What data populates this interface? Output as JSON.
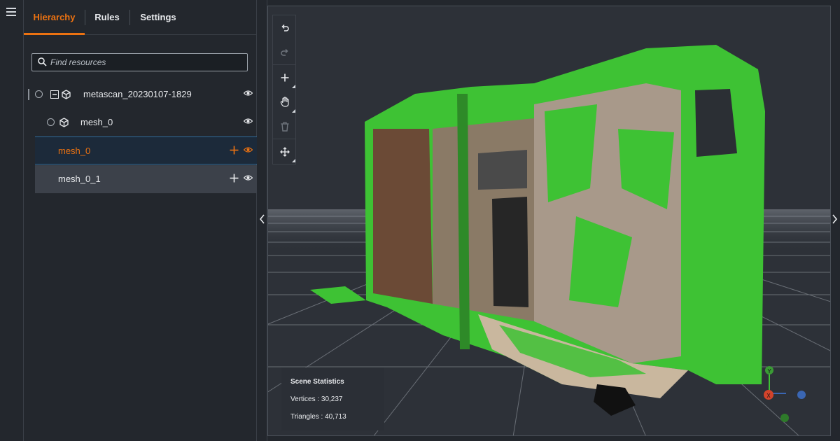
{
  "tabs": [
    {
      "label": "Hierarchy"
    },
    {
      "label": "Rules"
    },
    {
      "label": "Settings"
    }
  ],
  "search": {
    "placeholder": "Find resources"
  },
  "tree": {
    "root": {
      "label": "metascan_20230107-1829"
    },
    "child": {
      "label": "mesh_0"
    },
    "selected": {
      "label": "mesh_0"
    },
    "other": {
      "label": "mesh_0_1"
    }
  },
  "stats": {
    "title": "Scene Statistics",
    "vertices": "Vertices : 30,237",
    "triangles": "Triangles : 40,713"
  },
  "gizmo": {
    "y_label": "Y",
    "x_label": "X"
  },
  "colors": {
    "accent": "#ec7211",
    "mesh_green": "#3ec234"
  }
}
